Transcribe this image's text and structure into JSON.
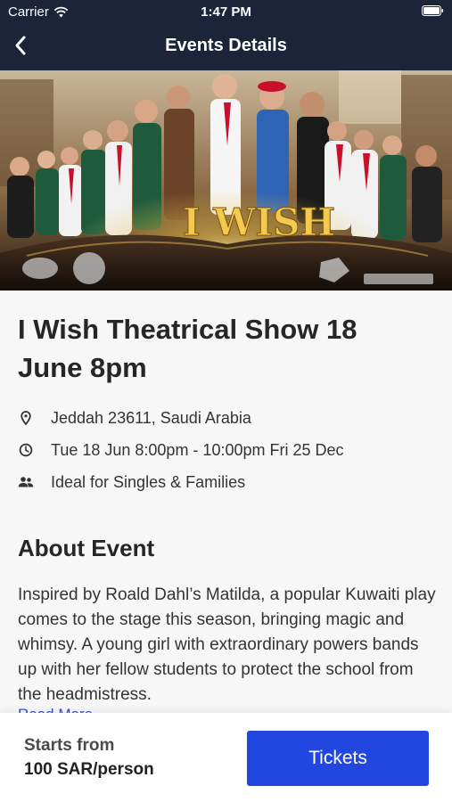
{
  "status": {
    "carrier": "Carrier",
    "time": "1:47 PM"
  },
  "nav": {
    "title": "Events Details",
    "back_icon": "chevron-left-icon"
  },
  "hero": {
    "logo_text": "I WISH",
    "description": "Theatrical show promotional poster"
  },
  "event": {
    "title": "I Wish Theatrical Show 18 June 8pm",
    "details": [
      {
        "icon": "location-pin-icon",
        "text": "Jeddah 23611, Saudi Arabia"
      },
      {
        "icon": "clock-icon",
        "text": "Tue 18 Jun 8:00pm - 10:00pm Fri 25 Dec"
      },
      {
        "icon": "people-icon",
        "text": "Ideal for Singles & Families"
      }
    ]
  },
  "about": {
    "title": "About Event",
    "text": "Inspired by Roald Dahl’s Matilda, a popular Kuwaiti play comes to the stage this season, bringing magic and whimsy. A young girl with extraordinary powers bands up with her fellow students to protect the school from the headmistress.",
    "read_more": "Read More"
  },
  "footer": {
    "price_label": "Starts from",
    "price_value": "100 SAR/person",
    "tickets_label": "Tickets"
  },
  "colors": {
    "navbar": "#1b2438",
    "accent": "#2246e0",
    "link": "#2b50d8"
  }
}
